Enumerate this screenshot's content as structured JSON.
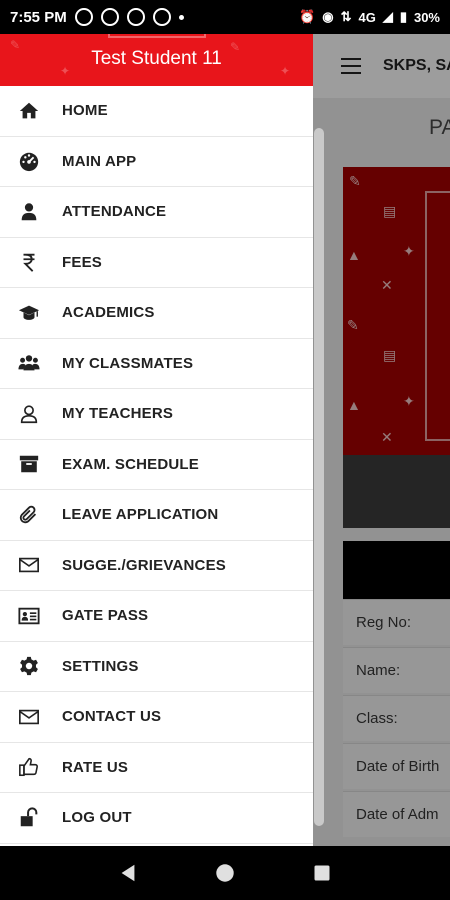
{
  "status_bar": {
    "time": "7:55 PM",
    "network": "4G",
    "battery": "30%"
  },
  "drawer": {
    "title": "Test Student 11",
    "header_color": "#e8151b",
    "items": [
      {
        "label": "HOME",
        "icon": "home-icon"
      },
      {
        "label": "MAIN APP",
        "icon": "dashboard-icon"
      },
      {
        "label": "ATTENDANCE",
        "icon": "person-icon"
      },
      {
        "label": "FEES",
        "icon": "rupee-icon"
      },
      {
        "label": "ACADEMICS",
        "icon": "graduation-cap-icon"
      },
      {
        "label": "MY CLASSMATES",
        "icon": "group-icon"
      },
      {
        "label": "MY TEACHERS",
        "icon": "user-outline-icon"
      },
      {
        "label": "EXAM. SCHEDULE",
        "icon": "archive-icon"
      },
      {
        "label": "LEAVE APPLICATION",
        "icon": "paperclip-icon"
      },
      {
        "label": "SUGGE./GRIEVANCES",
        "icon": "envelope-icon"
      },
      {
        "label": "GATE PASS",
        "icon": "id-card-icon"
      },
      {
        "label": "SETTINGS",
        "icon": "gear-icon"
      },
      {
        "label": "CONTACT US",
        "icon": "envelope-icon"
      },
      {
        "label": "RATE US",
        "icon": "thumbs-up-icon"
      },
      {
        "label": "LOG OUT",
        "icon": "unlock-icon"
      }
    ]
  },
  "app": {
    "title": "SKPS, SA",
    "page_heading": "PA",
    "info_rows": [
      "Reg No:",
      "Name:",
      "Class:",
      "Date of Birth",
      "Date of Adm"
    ],
    "banner_color": "#9b0000"
  }
}
